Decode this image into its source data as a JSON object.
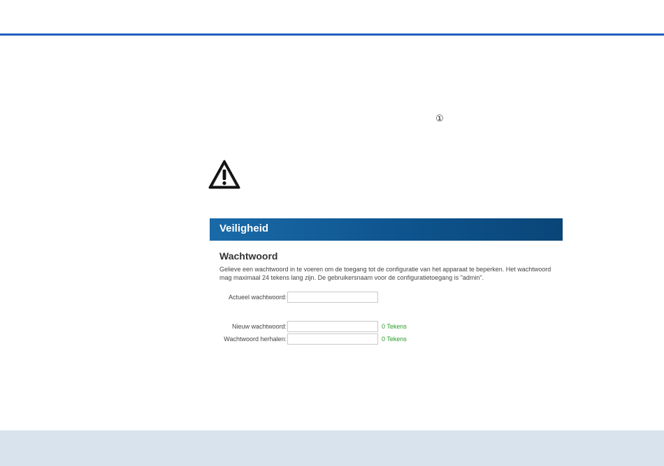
{
  "callout_marker": "①",
  "panel": {
    "header_title": "Veiligheid",
    "section_title": "Wachtwoord",
    "description": "Gelieve een wachtwoord in te voeren om de toegang tot de configuratie van het apparaat te beperken. Het wachtwoord mag maximaal 24 tekens lang zijn. De gebruikersnaam voor de configuratietoegang is \"admin\".",
    "fields": {
      "current_label": "Actueel wachtwoord:",
      "current_value": "",
      "new_label": "Nieuw wachtwoord:",
      "new_value": "",
      "new_counter": "0  Tekens",
      "repeat_label": "Wachtwoord herhalen:",
      "repeat_value": "",
      "repeat_counter": "0  Tekens"
    }
  },
  "colors": {
    "top_rule": "#1f5fbf",
    "header_bg": "#0e548e",
    "counter_text": "#2c9a2c",
    "footer_band": "#d8e3ee"
  }
}
